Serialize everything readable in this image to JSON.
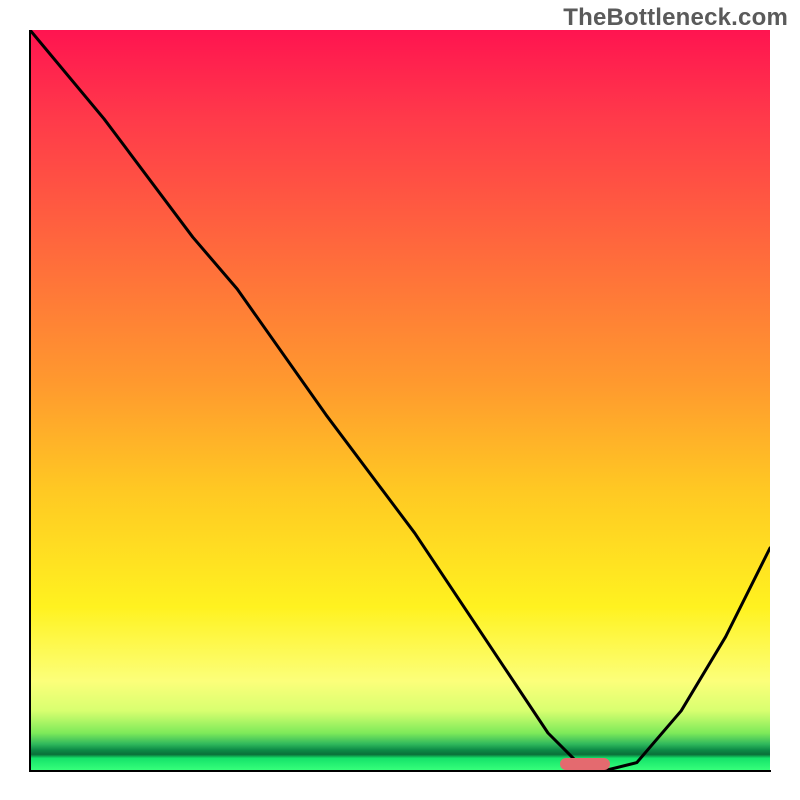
{
  "watermark": "TheBottleneck.com",
  "chart_data": {
    "type": "line",
    "title": "",
    "xlabel": "",
    "ylabel": "",
    "xlim": [
      0,
      100
    ],
    "ylim": [
      0,
      100
    ],
    "grid": false,
    "series": [
      {
        "name": "curve",
        "x": [
          0,
          10,
          22,
          28,
          40,
          52,
          64,
          70,
          74,
          78,
          82,
          88,
          94,
          100
        ],
        "y": [
          100,
          88,
          72,
          65,
          48,
          32,
          14,
          5,
          1,
          0,
          1,
          8,
          18,
          30
        ]
      }
    ],
    "marker": {
      "x_start": 71,
      "x_end": 78,
      "y": 0,
      "color": "#e46a6f"
    },
    "background_gradient": {
      "direction": "vertical",
      "stops": [
        {
          "pos": 0.0,
          "color": "#ff1450"
        },
        {
          "pos": 0.3,
          "color": "#ff6a3c"
        },
        {
          "pos": 0.62,
          "color": "#ffc823"
        },
        {
          "pos": 0.88,
          "color": "#fcff7a"
        },
        {
          "pos": 0.96,
          "color": "#2fb85c"
        },
        {
          "pos": 1.0,
          "color": "#36ff7a"
        }
      ]
    }
  }
}
